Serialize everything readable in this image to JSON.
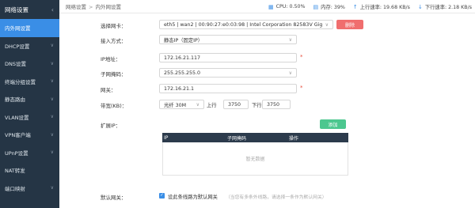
{
  "sidebar": {
    "title": "网络设置",
    "items": [
      {
        "label": "内外网设置",
        "active": true
      },
      {
        "label": "DHCP设置"
      },
      {
        "label": "DNS设置"
      },
      {
        "label": "终端分组设置"
      },
      {
        "label": "静态路由"
      },
      {
        "label": "VLAN设置"
      },
      {
        "label": "VPN客户端"
      },
      {
        "label": "UPnP设置"
      },
      {
        "label": "NAT转发"
      },
      {
        "label": "端口映射"
      }
    ]
  },
  "header": {
    "breadcrumb": [
      "网络设置",
      "内外网设置"
    ],
    "separator": ">",
    "stats": {
      "cpu": "CPU: 0.50%",
      "memory": "内存: 39%",
      "upload": "上行速率: 19.68 KB/s",
      "download": "下行速率: 2.18 KB/s"
    }
  },
  "form": {
    "nic_label": "选择网卡：",
    "nic_value": "eth5 | wan2 | 00:90:27:e0:03:98 | Intel Corporation 82583V Gigabit Ne",
    "delete_label": "删除",
    "access_label": "接入方式：",
    "access_value": "静态IP（固定IP）",
    "ip_label": "IP地址：",
    "ip_value": "172.16.21.117",
    "mask_label": "子网掩码：",
    "mask_value": "255.255.255.0",
    "gateway_label": "网关：",
    "gateway_value": "172.16.21.1",
    "bw_label": "带宽(KB)：",
    "bw_type": "光纤 30M",
    "up_label": "上行",
    "up_value": "3750",
    "down_label": "下行",
    "down_value": "3750",
    "extip_label": "扩展IP：",
    "add_label": "添加",
    "table_headers": [
      "IP",
      "子网掩码",
      "操作"
    ],
    "empty_text": "暂无数据",
    "default_gw_label": "默认网关：",
    "default_gw_checkbox": "设此条线路为默认网关",
    "default_gw_hint": "（当您有多条外线路，请选择一条作为默认网关）",
    "required_mark": "*"
  },
  "colors": {
    "sidebar_bg": "#253545",
    "active": "#3a8ee6",
    "delete": "#f06e6e",
    "add": "#4cc78f",
    "table_header": "#2c3b4c"
  }
}
